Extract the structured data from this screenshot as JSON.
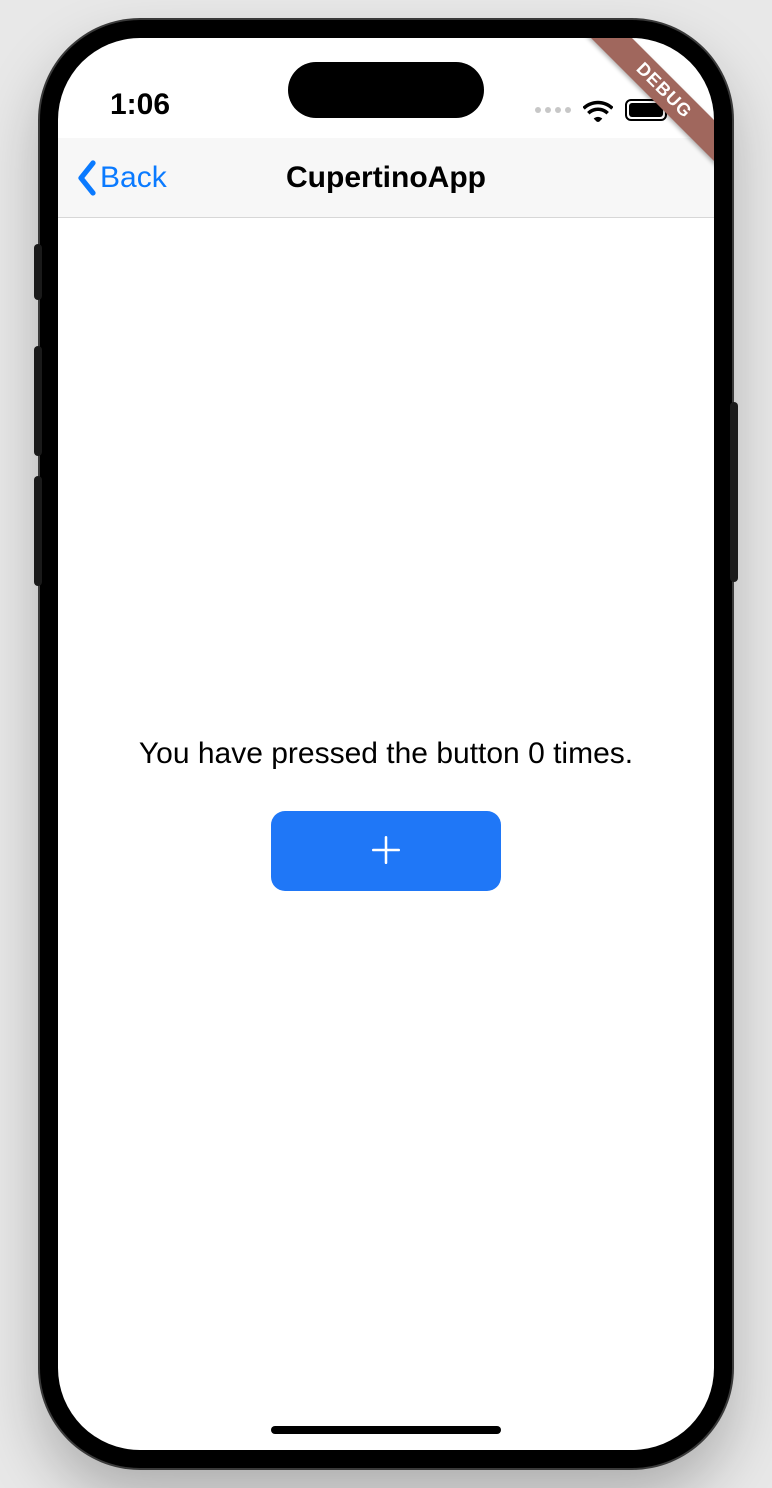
{
  "status": {
    "time": "1:06"
  },
  "debug": {
    "label": "DEBUG"
  },
  "nav": {
    "back_label": "Back",
    "title": "CupertinoApp"
  },
  "main": {
    "counter_text": "You have pressed the button 0 times."
  },
  "colors": {
    "accent": "#1f77f7",
    "ios_blue": "#0a7aff"
  }
}
